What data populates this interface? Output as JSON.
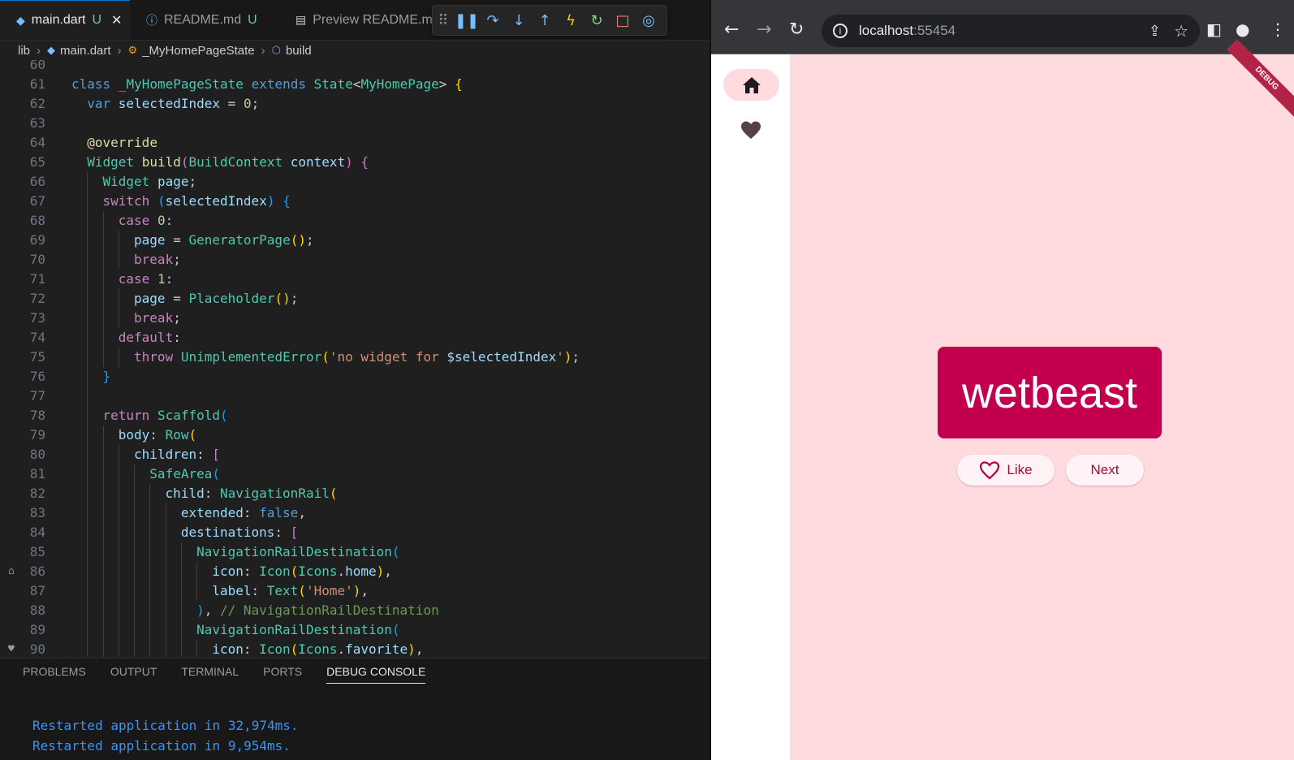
{
  "editor": {
    "tabs": [
      {
        "label": "main.dart",
        "badge": "U"
      },
      {
        "label": "README.md",
        "badge": "U"
      },
      {
        "label": "Preview README.md"
      }
    ],
    "breadcrumb": [
      "lib",
      "main.dart",
      "_MyHomePageState",
      "build"
    ],
    "lines": [
      {
        "n": "60",
        "indent": 0,
        "html": ""
      },
      {
        "n": "61",
        "indent": 0,
        "html": "<span class='kw'>class</span> <span class='cls'>_MyHomePageState</span> <span class='kw'>extends</span> <span class='cls'>State</span>&lt;<span class='cls'>MyHomePage</span>&gt; <span class='bk1'>{</span>"
      },
      {
        "n": "62",
        "indent": 1,
        "html": "<span class='kw'>var</span> <span class='var'>selectedIndex</span> = <span class='num'>0</span>;"
      },
      {
        "n": "63",
        "indent": 1,
        "html": ""
      },
      {
        "n": "64",
        "indent": 1,
        "html": "<span class='fn'>@override</span>"
      },
      {
        "n": "65",
        "indent": 1,
        "html": "<span class='cls'>Widget</span> <span class='fn'>build</span><span class='bk2'>(</span><span class='cls'>BuildContext</span> <span class='var'>context</span><span class='bk2'>)</span> <span class='bk2'>{</span>"
      },
      {
        "n": "66",
        "indent": 2,
        "html": "<span class='cls'>Widget</span> <span class='var'>page</span>;"
      },
      {
        "n": "67",
        "indent": 2,
        "html": "<span class='ctl'>switch</span> <span class='bk3'>(</span><span class='var'>selectedIndex</span><span class='bk3'>)</span> <span class='bk3'>{</span>"
      },
      {
        "n": "68",
        "indent": 3,
        "html": "<span class='ctl'>case</span> <span class='num'>0</span>:"
      },
      {
        "n": "69",
        "indent": 4,
        "html": "<span class='var'>page</span> = <span class='cls'>GeneratorPage</span><span class='bk1'>()</span>;"
      },
      {
        "n": "70",
        "indent": 4,
        "html": "<span class='ctl'>break</span>;"
      },
      {
        "n": "71",
        "indent": 3,
        "html": "<span class='ctl'>case</span> <span class='num'>1</span>:"
      },
      {
        "n": "72",
        "indent": 4,
        "html": "<span class='var'>page</span> = <span class='cls'>Placeholder</span><span class='bk1'>()</span>;"
      },
      {
        "n": "73",
        "indent": 4,
        "html": "<span class='ctl'>break</span>;"
      },
      {
        "n": "74",
        "indent": 3,
        "html": "<span class='ctl'>default</span>:"
      },
      {
        "n": "75",
        "indent": 4,
        "html": "<span class='ctl'>throw</span> <span class='cls'>UnimplementedError</span><span class='bk1'>(</span><span class='str'>'no widget for </span><span class='var'>$selectedIndex</span><span class='str'>'</span><span class='bk1'>)</span>;"
      },
      {
        "n": "76",
        "indent": 2,
        "html": "<span class='bk3'>}</span>"
      },
      {
        "n": "77",
        "indent": 2,
        "html": ""
      },
      {
        "n": "78",
        "indent": 2,
        "html": "<span class='ctl'>return</span> <span class='cls'>Scaffold</span><span class='bk3'>(</span>"
      },
      {
        "n": "79",
        "indent": 3,
        "html": "<span class='var'>body</span>: <span class='cls'>Row</span><span class='bk1'>(</span>"
      },
      {
        "n": "80",
        "indent": 4,
        "html": "<span class='var'>children</span>: <span class='bk2'>[</span>"
      },
      {
        "n": "81",
        "indent": 5,
        "html": "<span class='cls'>SafeArea</span><span class='bk3'>(</span>"
      },
      {
        "n": "82",
        "indent": 6,
        "html": "<span class='var'>child</span>: <span class='cls'>NavigationRail</span><span class='bk1'>(</span>"
      },
      {
        "n": "83",
        "indent": 7,
        "html": "<span class='var'>extended</span>: <span class='kw'>false</span>,"
      },
      {
        "n": "84",
        "indent": 7,
        "html": "<span class='var'>destinations</span>: <span class='bk2'>[</span>"
      },
      {
        "n": "85",
        "indent": 8,
        "html": "<span class='cls'>NavigationRailDestination</span><span class='bk3'>(</span>"
      },
      {
        "n": "86",
        "indent": 9,
        "html": "<span class='var'>icon</span>: <span class='cls'>Icon</span><span class='bk1'>(</span><span class='cls'>Icons</span>.<span class='var'>home</span><span class='bk1'>)</span>,",
        "gutter": "⌂"
      },
      {
        "n": "87",
        "indent": 9,
        "html": "<span class='var'>label</span>: <span class='cls'>Text</span><span class='bk1'>(</span><span class='str'>'Home'</span><span class='bk1'>)</span>,"
      },
      {
        "n": "88",
        "indent": 8,
        "html": "<span class='bk3'>)</span>, <span class='cm'>// NavigationRailDestination</span>"
      },
      {
        "n": "89",
        "indent": 8,
        "html": "<span class='cls'>NavigationRailDestination</span><span class='bk3'>(</span>"
      },
      {
        "n": "90",
        "indent": 9,
        "html": "<span class='var'>icon</span>: <span class='cls'>Icon</span><span class='bk1'>(</span><span class='cls'>Icons</span>.<span class='var'>favorite</span><span class='bk1'>)</span>,",
        "gutter": "♥"
      }
    ]
  },
  "panel": {
    "tabs": [
      "PROBLEMS",
      "OUTPUT",
      "TERMINAL",
      "PORTS",
      "DEBUG CONSOLE"
    ],
    "console": [
      "Restarted application in 32,974ms.",
      "Restarted application in 9,954ms."
    ]
  },
  "browser": {
    "url_host": "localhost",
    "url_port": ":55454",
    "debug_banner": "DEBUG",
    "word": "wetbeast",
    "like_label": "Like",
    "next_label": "Next"
  }
}
